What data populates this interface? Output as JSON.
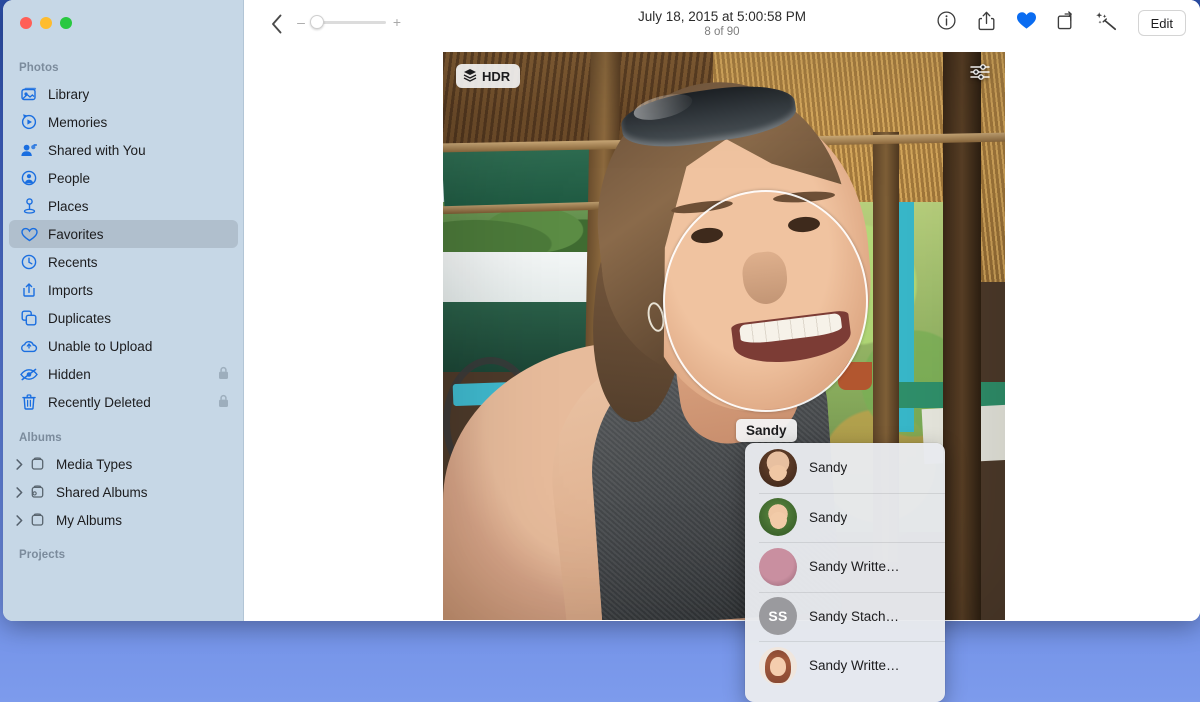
{
  "app": {
    "name": "Photos"
  },
  "window": {
    "traffic_lights": [
      {
        "name": "close",
        "color": "#ff5f57"
      },
      {
        "name": "minimize",
        "color": "#febc2e"
      },
      {
        "name": "zoom",
        "color": "#28c840"
      }
    ]
  },
  "sidebar": {
    "sections": [
      {
        "title": "Photos",
        "items": [
          {
            "label": "Library",
            "icon": "library-icon",
            "selected": false,
            "locked": false
          },
          {
            "label": "Memories",
            "icon": "memories-icon",
            "selected": false,
            "locked": false
          },
          {
            "label": "Shared with You",
            "icon": "shared-with-you-icon",
            "selected": false,
            "locked": false
          },
          {
            "label": "People",
            "icon": "people-icon",
            "selected": false,
            "locked": false
          },
          {
            "label": "Places",
            "icon": "places-icon",
            "selected": false,
            "locked": false
          },
          {
            "label": "Favorites",
            "icon": "heart-icon",
            "selected": true,
            "locked": false
          },
          {
            "label": "Recents",
            "icon": "clock-icon",
            "selected": false,
            "locked": false
          },
          {
            "label": "Imports",
            "icon": "imports-icon",
            "selected": false,
            "locked": false
          },
          {
            "label": "Duplicates",
            "icon": "duplicates-icon",
            "selected": false,
            "locked": false
          },
          {
            "label": "Unable to Upload",
            "icon": "cloud-icon",
            "selected": false,
            "locked": false
          },
          {
            "label": "Hidden",
            "icon": "eye-slash-icon",
            "selected": false,
            "locked": true
          },
          {
            "label": "Recently Deleted",
            "icon": "trash-icon",
            "selected": false,
            "locked": true
          }
        ]
      },
      {
        "title": "Albums",
        "items": [
          {
            "label": "Media Types",
            "icon": "album-icon",
            "disclosure": true
          },
          {
            "label": "Shared Albums",
            "icon": "shared-album-icon",
            "disclosure": true
          },
          {
            "label": "My Albums",
            "icon": "album-icon",
            "disclosure": true
          }
        ]
      },
      {
        "title": "Projects",
        "items": []
      }
    ]
  },
  "toolbar": {
    "back_icon": "chevron-left-icon",
    "zoom": {
      "minus": "–",
      "plus": "+",
      "value": 0
    },
    "title": "July 18, 2015 at 5:00:58 PM",
    "subtitle": "8 of 90",
    "actions": [
      {
        "name": "info-icon",
        "label": "Info"
      },
      {
        "name": "share-icon",
        "label": "Share"
      },
      {
        "name": "favorite-heart-icon",
        "label": "Favorite",
        "active": true,
        "color": "#0a6cf1"
      },
      {
        "name": "rotate-icon",
        "label": "Rotate"
      },
      {
        "name": "auto-enhance-icon",
        "label": "Auto Enhance"
      }
    ],
    "edit_label": "Edit"
  },
  "photo": {
    "hdr_badge": "HDR",
    "hdr_icon": "layers-icon",
    "adjust_icon": "sliders-icon",
    "face_tag": "Sandy"
  },
  "name_dropdown": {
    "items": [
      {
        "label": "Sandy",
        "avatar": "photo-portrait-dark-hair"
      },
      {
        "label": "Sandy",
        "avatar": "photo-portrait-green-bg"
      },
      {
        "label": "Sandy Writte…",
        "avatar": "photo-portrait-pink"
      },
      {
        "label": "Sandy Stach…",
        "avatar": "initials",
        "initials": "SS"
      },
      {
        "label": "Sandy Writte…",
        "avatar": "memoji"
      }
    ]
  }
}
